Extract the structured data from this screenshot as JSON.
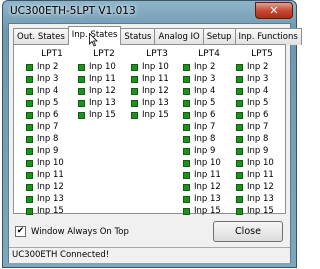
{
  "window": {
    "title": "UC300ETH-5LPT V1.013",
    "close_glyph": "✕"
  },
  "tabs": [
    {
      "label": "Out. States",
      "active": false
    },
    {
      "label": "Inp. States",
      "active": true
    },
    {
      "label": "Status",
      "active": false
    },
    {
      "label": "Analog IO",
      "active": false
    },
    {
      "label": "Setup",
      "active": false
    },
    {
      "label": "Inp. Functions",
      "active": false
    }
  ],
  "lpt_columns": [
    {
      "title": "LPT1",
      "inputs": [
        "Inp 2",
        "Inp 3",
        "Inp 4",
        "Inp 5",
        "Inp 6",
        "Inp 7",
        "Inp 8",
        "Inp 9",
        "Inp 10",
        "Inp 11",
        "Inp 12",
        "Inp 13",
        "Inp 15"
      ]
    },
    {
      "title": "LPT2",
      "inputs": [
        "Inp 10",
        "Inp 11",
        "Inp 12",
        "Inp 13",
        "Inp 15"
      ]
    },
    {
      "title": "LPT3",
      "inputs": [
        "Inp 10",
        "Inp 11",
        "Inp 12",
        "Inp 13",
        "Inp 15"
      ]
    },
    {
      "title": "LPT4",
      "inputs": [
        "Inp 2",
        "Inp 3",
        "Inp 4",
        "Inp 5",
        "Inp 6",
        "Inp 7",
        "Inp 8",
        "Inp 9",
        "Inp 10",
        "Inp 11",
        "Inp 12",
        "Inp 13",
        "Inp 15"
      ]
    },
    {
      "title": "LPT5",
      "inputs": [
        "Inp 2",
        "Inp 3",
        "Inp 4",
        "Inp 5",
        "Inp 6",
        "Inp 7",
        "Inp 8",
        "Inp 9",
        "Inp 10",
        "Inp 11",
        "Inp 12",
        "Inp 13",
        "Inp 15"
      ]
    }
  ],
  "options": {
    "always_on_top_label": "Window Always On Top",
    "always_on_top_checked": true
  },
  "buttons": {
    "close_label": "Close"
  },
  "status": {
    "text": "UC300ETH Connected!"
  },
  "colors": {
    "led_active": "#1f8f1f"
  }
}
